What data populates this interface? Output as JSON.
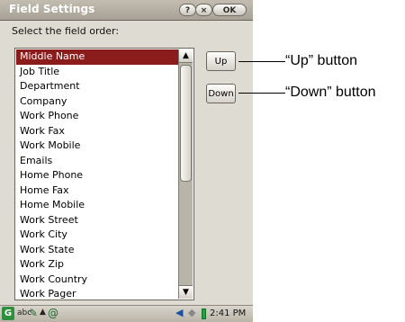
{
  "window": {
    "title": "Field Settings",
    "help_label": "?",
    "close_label": "×",
    "ok_label": "OK"
  },
  "prompt": "Select the field order:",
  "list": {
    "items": [
      "Middle Name",
      "Job Title",
      "Department",
      "Company",
      "Work Phone",
      "Work Fax",
      "Work Mobile",
      "Emails",
      "Home Phone",
      "Home Fax",
      "Home Mobile",
      "Work Street",
      "Work City",
      "Work State",
      "Work Zip",
      "Work Country",
      "Work Pager"
    ],
    "selected_index": 0
  },
  "scrollbar": {
    "up_arrow": "▲",
    "down_arrow": "▼"
  },
  "buttons": {
    "up_label": "Up",
    "down_label": "Down"
  },
  "taskbar": {
    "start_glyph": "G",
    "abc_label": "abc",
    "pen_glyph": "✎",
    "arrow_glyph": "▲",
    "email_glyph": "@",
    "speaker_glyph": "◀",
    "diamond_glyph": "◆",
    "time": "2:41 PM"
  },
  "annotations": {
    "up": "“Up” button",
    "down": "“Down” button"
  }
}
